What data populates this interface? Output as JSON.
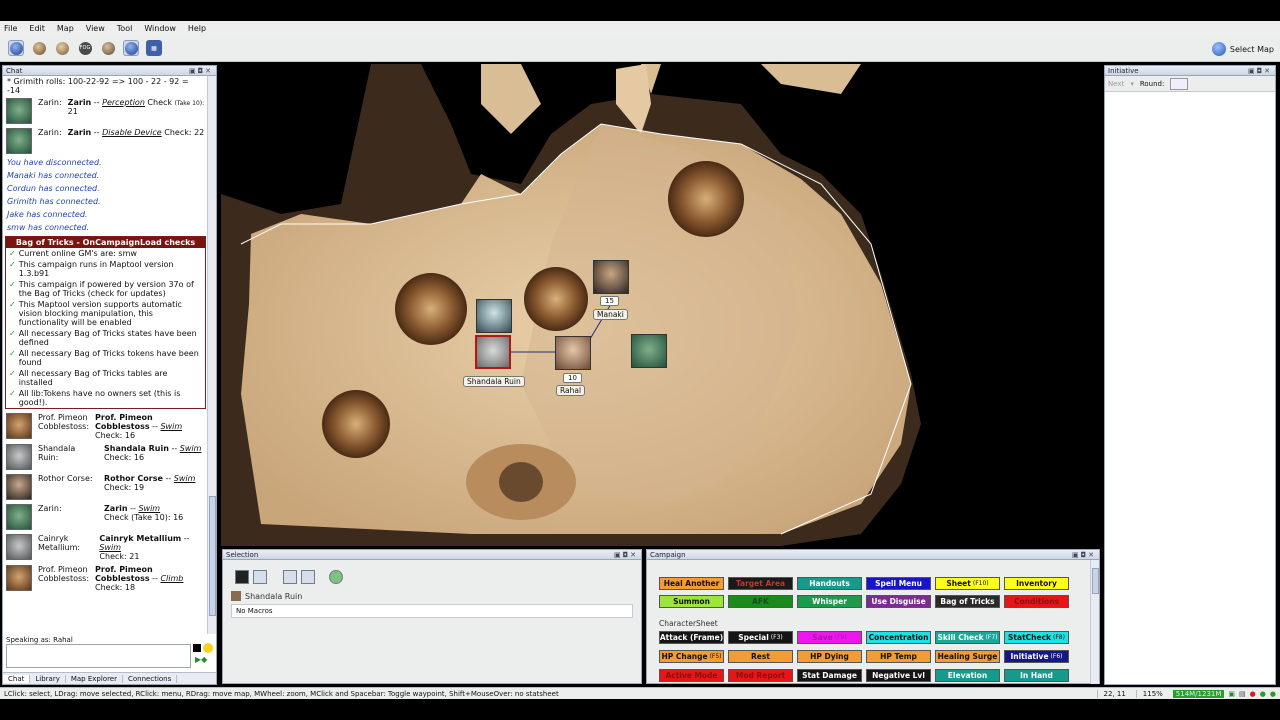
{
  "menu": [
    "File",
    "Edit",
    "Map",
    "View",
    "Tool",
    "Window",
    "Help"
  ],
  "toolbar": {
    "fog_label": "FOG",
    "select_map": "Select Map"
  },
  "chat": {
    "title": "Chat",
    "roll_line": "* Grimith rolls: 100-22-92 => 100 - 22 - 92 = -14",
    "messages": [
      {
        "speaker": "Zarin:",
        "who": "Zarin",
        "skill": "Perception",
        "rest": " Check ",
        "note": "(Take 10):",
        "value": " 21"
      },
      {
        "speaker": "Zarin:",
        "who": "Zarin",
        "skill": "Disable Device",
        "rest": " Check: 22",
        "note": "",
        "value": ""
      }
    ],
    "system": [
      "You have disconnected.",
      "Manaki has connected.",
      "Cordun has connected.",
      "Grimith has connected.",
      "Jake has connected.",
      "smw has connected."
    ],
    "bot": {
      "title": "Bag of Tricks - OnCampaignLoad checks",
      "rows": [
        "Current online GM's are: smw",
        "This campaign runs in Maptool version 1.3.b91",
        "This campaign if powered by version 37o of the Bag of Tricks (check for updates)",
        "This Maptool version supports automatic vision blocking manipulation, this functionality will be enabled",
        "All necessary Bag of Tricks states have been defined",
        "All necessary Bag of Tricks tokens have been found",
        "All necessary Bag of Tricks tables are installed",
        "All lib:Tokens have no owners set (this is good!)."
      ]
    },
    "checks": [
      {
        "speaker": "Prof. Pimeon Cobblestoss:",
        "who": "Prof. Pimeon Cobblestoss",
        "skill": "Swim",
        "tail": "Check: 16",
        "av": "brown"
      },
      {
        "speaker": "Shandala Ruin:",
        "who": "Shandala Ruin",
        "skill": "Swim",
        "tail": "Check: 16",
        "av": "gray"
      },
      {
        "speaker": "Rothor Corse:",
        "who": "Rothor Corse",
        "skill": "Swim",
        "tail": "Check: 19",
        "av": "dark"
      },
      {
        "speaker": "Zarin:",
        "who": "Zarin",
        "skill": "Swim",
        "tail": "Check (Take 10): 16",
        "av": "green"
      },
      {
        "speaker": "Cainryk Metallium:",
        "who": "Cainryk Metallium",
        "skill": "Swim",
        "tail": "Check: 21",
        "av": "gray"
      },
      {
        "speaker": "Prof. Pimeon Cobblestoss:",
        "who": "Prof. Pimeon Cobblestoss",
        "skill": "Climb",
        "tail": "Check: 18",
        "av": "brown"
      }
    ],
    "speaking_as": "Speaking as: Rahal",
    "tabs": [
      "Chat",
      "Library",
      "Map Explorer",
      "Connections"
    ]
  },
  "map": {
    "tokens": [
      {
        "label": "Shandala Ruin"
      },
      {
        "label": "Manaki",
        "num": "15"
      },
      {
        "label": "Rahal",
        "num": "10"
      }
    ]
  },
  "selection": {
    "title": "Selection",
    "group": "Shandala Ruin",
    "no_macros": "No Macros"
  },
  "campaign": {
    "title": "Campaign",
    "row1": [
      {
        "label": "Heal Another",
        "bg": "#f39c33",
        "fg": "#111"
      },
      {
        "label": "Target Area",
        "bg": "#1a1a1a",
        "fg": "#c0392b"
      },
      {
        "label": "Handouts",
        "bg": "#169a8e",
        "fg": "#fff"
      },
      {
        "label": "Spell Menu",
        "bg": "#1616c8",
        "fg": "#fff"
      },
      {
        "label": "Sheet",
        "key": "(F10)",
        "bg": "#ffff1a",
        "fg": "#111"
      },
      {
        "label": "Inventory",
        "bg": "#ffff1a",
        "fg": "#111"
      },
      {
        "label": "Summon",
        "bg": "#9be63a",
        "fg": "#111"
      },
      {
        "label": "AFK",
        "bg": "#1a8a1a",
        "fg": "#1a4a1a"
      },
      {
        "label": "Whisper",
        "bg": "#1f9a4a",
        "fg": "#fff"
      },
      {
        "label": "Use Disguise",
        "bg": "#7b2c8f",
        "fg": "#fff"
      },
      {
        "label": "Bag of Tricks",
        "bg": "#2a2a2a",
        "fg": "#fff"
      },
      {
        "label": "Conditions",
        "bg": "#e41616",
        "fg": "#8a1010"
      }
    ],
    "group_label": "CharacterSheet",
    "row2": [
      {
        "label": "Attack (Frame)",
        "bg": "#151515",
        "fg": "#fff"
      },
      {
        "label": "Special",
        "key": "(F3)",
        "bg": "#151515",
        "fg": "#fff"
      },
      {
        "label": "Save",
        "key": "(F9)",
        "bg": "#ee16ee",
        "fg": "#b012b0"
      },
      {
        "label": "Concentration",
        "bg": "#19e3e3",
        "fg": "#111"
      },
      {
        "label": "Skill Check",
        "key": "(F7)",
        "bg": "#19a99a",
        "fg": "#fff"
      },
      {
        "label": "StatCheck",
        "key": "(F8)",
        "bg": "#19e3e3",
        "fg": "#111"
      },
      {
        "label": "HP Change",
        "key": "(F5)",
        "bg": "#f39c33",
        "fg": "#111"
      },
      {
        "label": "Rest",
        "bg": "#f39c33",
        "fg": "#111"
      },
      {
        "label": "HP Dying",
        "bg": "#f39c33",
        "fg": "#111"
      },
      {
        "label": "HP Temp",
        "bg": "#f39c33",
        "fg": "#111"
      },
      {
        "label": "Healing Surge",
        "bg": "#f39c33",
        "fg": "#111"
      },
      {
        "label": "Initiative",
        "key": "(F6)",
        "bg": "#16168a",
        "fg": "#fff"
      },
      {
        "label": "Active Mode",
        "bg": "#e41616",
        "fg": "#8a1010"
      },
      {
        "label": "Mod Report",
        "bg": "#e41616",
        "fg": "#8a1010"
      },
      {
        "label": "Stat Damage",
        "bg": "#151515",
        "fg": "#fff"
      },
      {
        "label": "Negative Lvl",
        "bg": "#151515",
        "fg": "#fff"
      },
      {
        "label": "Elevation",
        "bg": "#169a8e",
        "fg": "#fff"
      },
      {
        "label": "In Hand",
        "bg": "#169a8e",
        "fg": "#fff"
      }
    ]
  },
  "initiative": {
    "title": "Initiative",
    "next": "Next",
    "round": "Round:"
  },
  "status": {
    "hint": "LClick: select, LDrag: move selected, RClick: menu, RDrag: move map, MWheel: zoom, MClick and Spacebar: Toggle waypoint, Shift+MouseOver: no statsheet",
    "coords": "22, 11",
    "zoom": "115%",
    "memory": "514M/1231M"
  },
  "colors": {
    "bot_header": "#7a1410",
    "system_text": "#2345b5",
    "check_green": "#2a9c2a"
  }
}
